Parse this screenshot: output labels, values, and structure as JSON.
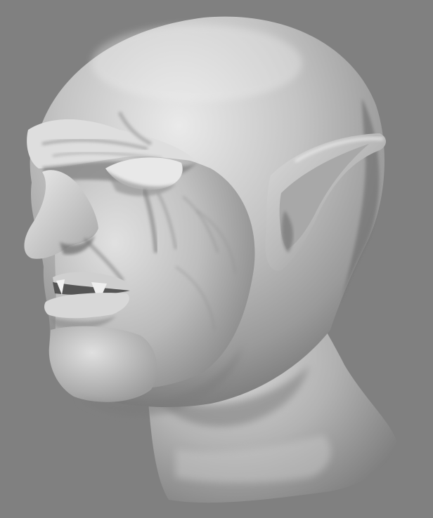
{
  "scene": {
    "background_color": "#808080",
    "material_light": "#e2e2e2",
    "material_mid": "#b4b4b4",
    "material_shadow": "#6e6e6e",
    "material_deep_shadow": "#505050",
    "subject": "sculpted-goblin-head-icon"
  }
}
